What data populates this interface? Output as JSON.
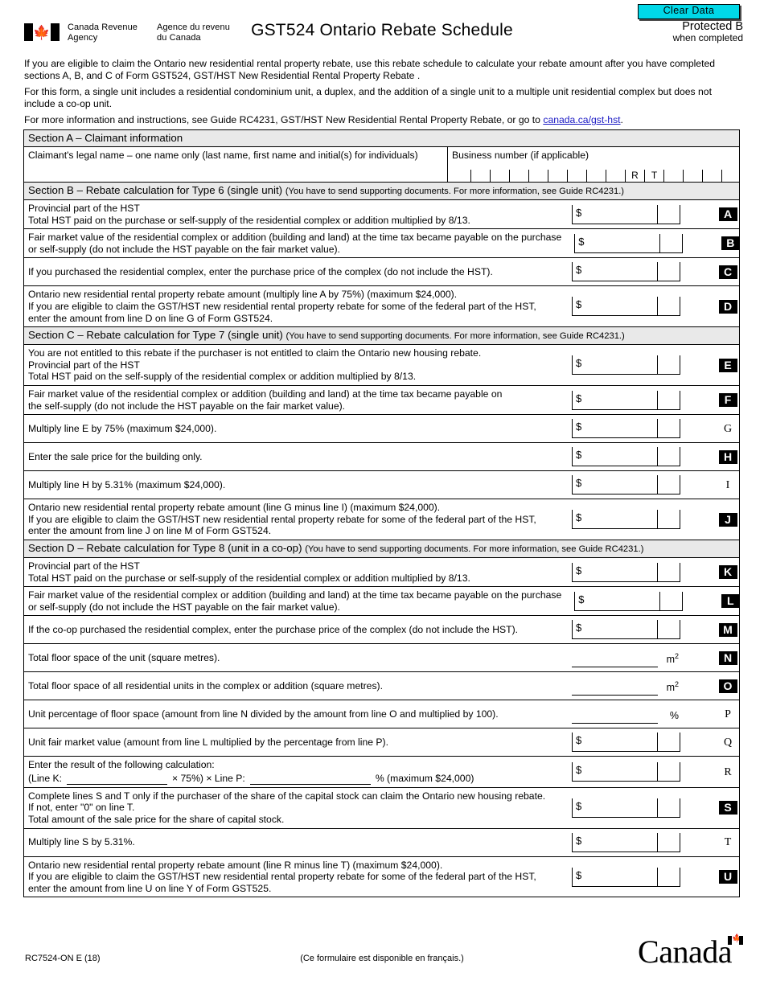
{
  "toolbar": {
    "clear_data_label": "Clear Data"
  },
  "header": {
    "agency_en_line1": "Canada Revenue",
    "agency_en_line2": "Agency",
    "agency_fr_line1": "Agence du revenu",
    "agency_fr_line2": "du Canada",
    "title": "GST524 Ontario Rebate Schedule",
    "protected_line1": "Protected B",
    "protected_line2": "when completed"
  },
  "intro": {
    "p1": "If you are eligible to claim the Ontario new residential rental property rebate, use this rebate schedule to calculate your rebate amount after you have completed sections A, B, and C of Form GST524, GST/HST New Residential Rental Property Rebate .",
    "p2": "For this form, a single unit includes a residential condominium unit, a duplex, and the addition of a single unit to a multiple unit residential complex but does not include a co-op unit.",
    "p3_pre": "For more information and instructions, see Guide RC4231, GST/HST New Residential Rental Property Rebate, or go to ",
    "p3_link": "canada.ca/gst-hst",
    "p3_post": "."
  },
  "sectionA": {
    "heading": "Section A – Claimant information",
    "claimant_name_label": "Claimant's legal name – one name only (last name, first name and initial(s) for individuals)",
    "claimant_name_value": "",
    "business_number_label": "Business number (if applicable)",
    "business_number_value": "",
    "bn_program_r": "R",
    "bn_program_t": "T"
  },
  "sectionB": {
    "heading_main": "Section B – Rebate calculation for Type 6  (single unit)",
    "heading_note": "(You have to send supporting documents. For more information, see Guide RC4231.)",
    "rows": [
      {
        "lines": [
          "Provincial part of the HST",
          "Total HST paid on the purchase or self-supply of the residential complex or addition multiplied by 8/13."
        ],
        "tag": "A",
        "tag_style": "inverted",
        "field": "money",
        "value": ""
      },
      {
        "lines": [
          "Fair market value of the residential complex or addition (building and land) at the time tax became payable on the purchase",
          "or self-supply (do not include the HST payable on the fair market value)."
        ],
        "tag": "B",
        "tag_style": "inverted",
        "field": "money",
        "value": ""
      },
      {
        "lines": [
          "If you purchased the residential complex, enter the purchase price of the complex (do not include the HST)."
        ],
        "tag": "C",
        "tag_style": "inverted",
        "field": "money",
        "value": ""
      },
      {
        "lines": [
          "Ontario new residential rental property rebate amount (multiply line A by 75%) (maximum $24,000).",
          "If you are eligible to claim the GST/HST new residential rental property rebate for some of the federal part of the HST,",
          "enter the amount from line D on line G of Form GST524."
        ],
        "tag": "D",
        "tag_style": "inverted",
        "field": "money",
        "value": ""
      }
    ]
  },
  "sectionC": {
    "heading_main": "Section C – Rebate calculation for Type 7 (single unit)",
    "heading_note": "(You have to send supporting documents. For more information, see Guide RC4231.)",
    "rows": [
      {
        "lines": [
          "You are not entitled to this rebate if the purchaser is not entitled to claim the Ontario new housing rebate.",
          "Provincial part of the HST",
          "Total HST paid on the self-supply of the residential complex or addition multiplied by 8/13."
        ],
        "tag": "E",
        "tag_style": "inverted",
        "field": "money",
        "value": ""
      },
      {
        "lines": [
          "Fair market value of the residential complex or addition (building and land) at the time tax became payable on",
          "the self-supply (do not include the HST payable on the fair market value)."
        ],
        "tag": "F",
        "tag_style": "inverted",
        "field": "money",
        "value": ""
      },
      {
        "lines": [
          "Multiply line E by 75% (maximum $24,000)."
        ],
        "tag": "G",
        "tag_style": "plain",
        "field": "money",
        "value": ""
      },
      {
        "lines": [
          "Enter the sale price for the building only."
        ],
        "tag": "H",
        "tag_style": "inverted",
        "field": "money",
        "value": ""
      },
      {
        "lines": [
          "Multiply line H by 5.31% (maximum $24,000)."
        ],
        "tag": "I",
        "tag_style": "plain",
        "field": "money",
        "value": ""
      },
      {
        "lines": [
          "Ontario new residential rental property rebate amount (line G minus line I) (maximum $24,000).",
          "If you are eligible to claim the GST/HST new residential rental property rebate for some of the federal part of the HST,",
          "enter the amount from line J  on line M of Form GST524."
        ],
        "tag": "J",
        "tag_style": "inverted",
        "field": "money",
        "value": ""
      }
    ]
  },
  "sectionD": {
    "heading_main": "Section D – Rebate calculation for Type 8 (unit in a co-op)",
    "heading_note": "(You have to send supporting documents. For more information, see Guide RC4231.)",
    "rows": [
      {
        "lines": [
          "Provincial part of the HST",
          "Total HST paid on the purchase or self-supply of the residential complex or addition multiplied by 8/13."
        ],
        "tag": "K",
        "tag_style": "inverted",
        "field": "money",
        "value": ""
      },
      {
        "lines": [
          "Fair market value of the residential complex or addition (building and land) at the time tax became payable on the purchase",
          "or self-supply (do not include the HST payable on the fair market value)."
        ],
        "tag": "L",
        "tag_style": "inverted",
        "field": "money",
        "value": ""
      },
      {
        "lines": [
          "If the co-op purchased the residential complex, enter the purchase price of the complex (do not include the HST)."
        ],
        "tag": "M",
        "tag_style": "inverted",
        "field": "money",
        "value": ""
      },
      {
        "lines": [
          "Total floor space of the unit (square metres)."
        ],
        "tag": "N",
        "tag_style": "inverted",
        "field": "plain",
        "unit": "m2",
        "value": ""
      },
      {
        "lines": [
          "Total floor space of all residential units in the complex or addition (square metres)."
        ],
        "tag": "O",
        "tag_style": "inverted",
        "field": "plain",
        "unit": "m2",
        "value": ""
      },
      {
        "lines": [
          "Unit percentage of floor space (amount from line N divided by the amount from line O and multiplied by 100)."
        ],
        "tag": "P",
        "tag_style": "plain",
        "field": "plain",
        "unit": "%",
        "value": ""
      },
      {
        "lines": [
          "Unit fair market value (amount from line L multiplied by the percentage from line P)."
        ],
        "tag": "Q",
        "tag_style": "plain",
        "field": "money",
        "value": ""
      },
      {
        "lines": [
          "Enter the result of the following calculation:"
        ],
        "tag": "R",
        "tag_style": "plain",
        "field": "money",
        "value": "",
        "calc": {
          "prefix": "(Line K:",
          "mid": "×   75%)   ×   Line P:",
          "suffix": "% (maximum $24,000)",
          "line_k_value": "",
          "line_p_value": ""
        }
      },
      {
        "lines": [
          "Complete lines S and T only if the purchaser of the share of the capital stock can claim the Ontario new housing rebate.",
          "If not, enter \"0\" on line T.",
          "Total amount of the sale price for the share of capital stock."
        ],
        "tag": "S",
        "tag_style": "inverted",
        "field": "money",
        "value": ""
      },
      {
        "lines": [
          "Multiply line S by 5.31%."
        ],
        "tag": "T",
        "tag_style": "plain",
        "field": "money",
        "value": ""
      },
      {
        "lines": [
          "Ontario new residential rental property rebate amount (line R minus line T) (maximum $24,000).",
          "If you are eligible to claim the GST/HST new residential rental property rebate for some of the federal part of the HST,",
          "enter the amount from line U on line Y of Form GST525."
        ],
        "tag": "U",
        "tag_style": "inverted",
        "field": "money",
        "value": ""
      }
    ]
  },
  "footer": {
    "form_code": "RC7524-ON E (18)",
    "french_note": "(Ce formulaire est disponible en français.)",
    "wordmark": "Canada"
  },
  "colors": {
    "clear_data_bg": "#00d8e8",
    "section_header_bg": "#e9e9e9",
    "link": "#1a19c4",
    "tag_inverted_bg": "#000000"
  }
}
